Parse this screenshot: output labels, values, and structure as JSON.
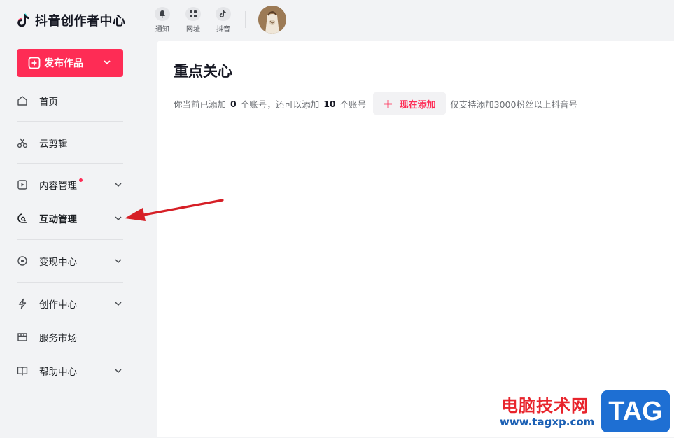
{
  "brand": {
    "name": "抖音创作者中心",
    "accent": "#fe2c55"
  },
  "sidebar": {
    "publish_label": "发布作品",
    "items": [
      {
        "label": "首页",
        "icon": "home-icon",
        "has_chevron": false
      },
      {
        "label": "云剪辑",
        "icon": "scissors-icon",
        "has_chevron": false
      },
      {
        "label": "内容管理",
        "icon": "play-square-icon",
        "has_chevron": true,
        "has_dot": true
      },
      {
        "label": "互动管理",
        "icon": "chat-search-icon",
        "has_chevron": true
      },
      {
        "label": "变现中心",
        "icon": "coin-icon",
        "has_chevron": true
      },
      {
        "label": "创作中心",
        "icon": "lightning-icon",
        "has_chevron": true
      },
      {
        "label": "服务市场",
        "icon": "store-icon",
        "has_chevron": false
      },
      {
        "label": "帮助中心",
        "icon": "book-icon",
        "has_chevron": true
      }
    ]
  },
  "topbar": {
    "buttons": [
      {
        "label": "通知",
        "icon": "bell-icon"
      },
      {
        "label": "网址",
        "icon": "grid-icon"
      },
      {
        "label": "抖音",
        "icon": "douyin-icon"
      }
    ]
  },
  "main": {
    "title": "重点关心",
    "info_prefix": "你当前已添加",
    "added_count": "0",
    "info_middle": "个账号，还可以添加",
    "remaining_count": "10",
    "info_suffix": "个账号",
    "add_button_label": "现在添加",
    "note": "仅支持添加3000粉丝以上抖音号"
  },
  "watermark": {
    "site_name": "电脑技术网",
    "url": "www.tagxp.com",
    "badge": "TAG"
  }
}
